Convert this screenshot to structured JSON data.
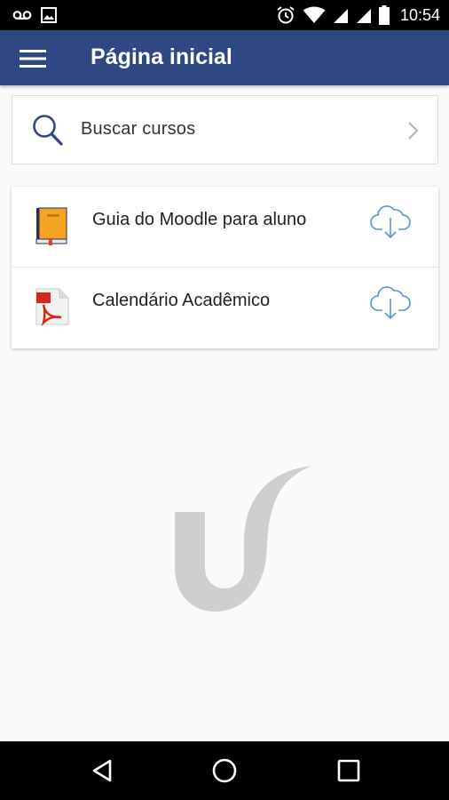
{
  "status_bar": {
    "time": "10:54",
    "icons": [
      "voicemail-icon",
      "image-icon",
      "alarm-icon",
      "wifi-icon",
      "signal-icon",
      "signal-icon",
      "battery-icon"
    ]
  },
  "app_bar": {
    "title": "Página inicial",
    "menu_icon": "hamburger-menu-icon",
    "color": "#2f4782"
  },
  "search": {
    "label": "Buscar cursos",
    "icon": "search-icon"
  },
  "files": [
    {
      "label": "Guia do Moodle para aluno",
      "icon": "book-icon",
      "action_icon": "cloud-download-icon"
    },
    {
      "label": "Calendário Acadêmico",
      "icon": "pdf-icon",
      "action_icon": "cloud-download-icon"
    }
  ],
  "nav_bar": {
    "buttons": [
      "back-icon",
      "home-icon",
      "recents-icon"
    ]
  },
  "colors": {
    "accent": "#2f4782",
    "download": "#5b8fd6",
    "logo": "#cfcfcf"
  }
}
